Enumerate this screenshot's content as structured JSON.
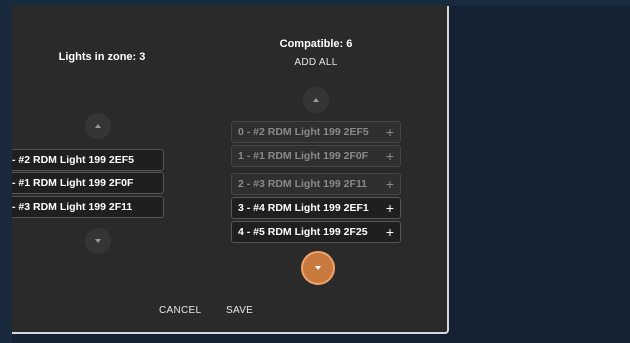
{
  "left": {
    "title": "Lights in zone: 3",
    "items": [
      "- #2 RDM Light 199 2EF5",
      "- #1 RDM Light 199 2F0F",
      "- #3 RDM Light 199 2F11"
    ]
  },
  "right": {
    "title": "Compatible: 6",
    "add_all": "ADD ALL",
    "items": [
      {
        "label": "0 - #2 RDM Light 199 2EF5",
        "action": "+"
      },
      {
        "label": "1 - #1 RDM Light 199 2F0F",
        "action": "+"
      },
      {
        "label": "2 - #3 RDM Light 199 2F11",
        "action": "+"
      },
      {
        "label": "3 - #4 RDM Light 199 2EF1",
        "action": "+"
      },
      {
        "label": "4 - #5 RDM Light 199 2F25",
        "action": "+"
      }
    ]
  },
  "footer": {
    "cancel": "CANCEL",
    "save": "SAVE"
  },
  "colors": {
    "accent": "#c87a3e",
    "panel": "#2a2a2a",
    "background": "#152234"
  },
  "icons": {
    "scroll_up": "chevron-up-icon",
    "scroll_down": "chevron-down-icon",
    "add": "plus-icon"
  }
}
